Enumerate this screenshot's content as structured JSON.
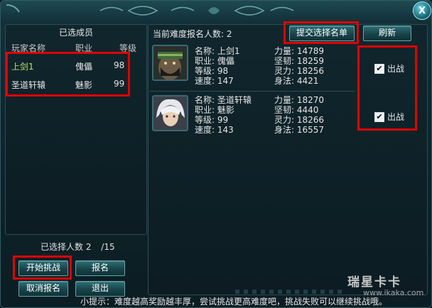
{
  "left_panel": {
    "title": "已选成员",
    "columns": [
      "玩家名称",
      "职业",
      "等级"
    ],
    "rows": [
      {
        "name": "上剑1",
        "class": "傀儡",
        "level": "98"
      },
      {
        "name": "圣道轩辕",
        "class": "魅影",
        "level": "99"
      }
    ],
    "selected_label": "已选择人数 2",
    "selected_max": "/15"
  },
  "buttons": {
    "start": "开始挑战",
    "signup": "报名",
    "cancel_signup": "取消报名",
    "exit": "退出",
    "submit": "提交选择名单",
    "refresh": "刷新"
  },
  "right_panel": {
    "header": "当前难度报名人数: 2",
    "players": [
      {
        "name_label": "名称:",
        "name": "上剑1",
        "class_label": "职业:",
        "class": "傀儡",
        "level_label": "等级:",
        "level": "98",
        "speed_label": "速度:",
        "speed": "147",
        "strength_label": "力量:",
        "strength": "14789",
        "toughness_label": "坚韧:",
        "toughness": "18259",
        "spirit_label": "灵力:",
        "spirit": "18256",
        "agility_label": "身法:",
        "agility": "4421",
        "checkbox_label": "出战",
        "checked": true
      },
      {
        "name_label": "名称:",
        "name": "圣道轩辕",
        "class_label": "职业:",
        "class": "魅影",
        "level_label": "等级:",
        "level": "99",
        "speed_label": "速度:",
        "speed": "143",
        "strength_label": "力量:",
        "strength": "18270",
        "toughness_label": "坚韧:",
        "toughness": "4440",
        "spirit_label": "灵力:",
        "spirit": "18266",
        "agility_label": "身法:",
        "agility": "16557",
        "checkbox_label": "出战",
        "checked": true
      }
    ]
  },
  "tip": "小提示：难度越高奖励越丰厚，尝试挑战更高难度吧，挑战失败可以继续挑战哦。",
  "watermark": {
    "main": "瑞星卡卡",
    "sub": "www.ikaka.com"
  },
  "close_glyph": "X",
  "check_glyph": "✔",
  "colors": {
    "highlight": "#e00000",
    "name_green": "#b6e36a",
    "panel_border": "#2b4e56"
  }
}
